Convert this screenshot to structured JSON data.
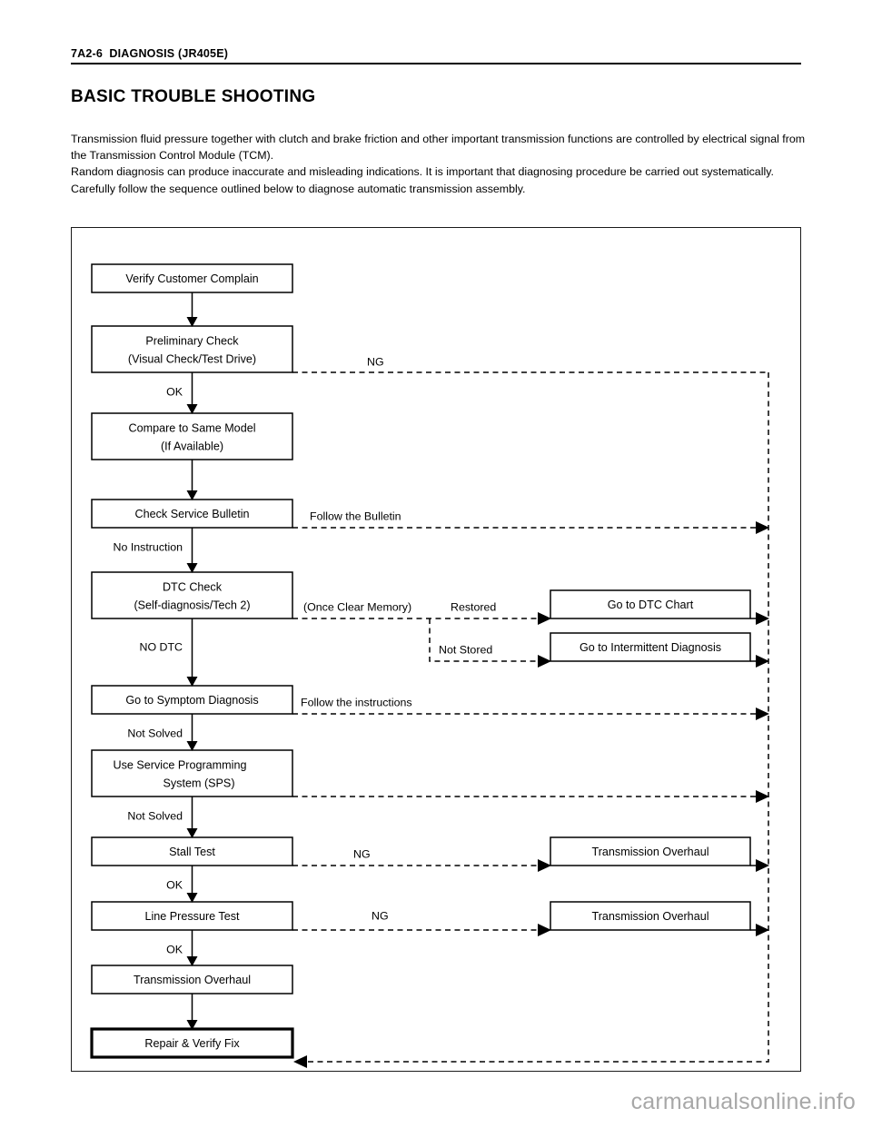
{
  "header": {
    "running_head": "7A2-6  DIAGNOSIS (JR405E)",
    "section_title": "BASIC TROUBLE SHOOTING"
  },
  "intro": {
    "para1": "Transmission fluid pressure together with clutch and brake friction and other important transmission functions are controlled by electrical signal from the Transmission Control Module (TCM).",
    "para2": "Random diagnosis can produce inaccurate and misleading indications. It is important that diagnosing procedure be carried out systematically.",
    "para3": "Carefully follow the sequence outlined below to diagnose automatic transmission assembly."
  },
  "flowchart": {
    "nodes": [
      {
        "id": "verify",
        "line1": "Verify Customer Complain",
        "line2": ""
      },
      {
        "id": "preliminary",
        "line1": "Preliminary Check",
        "line2": "(Visual Check/Test Drive)"
      },
      {
        "id": "compare",
        "line1": "Compare to Same Model",
        "line2": "(If Available)"
      },
      {
        "id": "bulletin",
        "line1": "Check Service Bulletin",
        "line2": ""
      },
      {
        "id": "dtccheck",
        "line1": "DTC Check",
        "line2": "(Self-diagnosis/Tech 2)"
      },
      {
        "id": "symptom",
        "line1": "Go to Symptom Diagnosis",
        "line2": ""
      },
      {
        "id": "sps",
        "line1": "Use Service Programming",
        "line2": "System (SPS)"
      },
      {
        "id": "stall",
        "line1": "Stall Test",
        "line2": ""
      },
      {
        "id": "linepressure",
        "line1": "Line Pressure Test",
        "line2": ""
      },
      {
        "id": "overhaul-main",
        "line1": "Transmission Overhaul",
        "line2": ""
      },
      {
        "id": "repair",
        "line1": "Repair & Verify Fix",
        "line2": ""
      },
      {
        "id": "dtcchart",
        "line1": "Go to DTC Chart",
        "line2": ""
      },
      {
        "id": "intermittent",
        "line1": "Go to Intermittent Diagnosis",
        "line2": ""
      },
      {
        "id": "overhaul-stall",
        "line1": "Transmission Overhaul",
        "line2": ""
      },
      {
        "id": "overhaul-line",
        "line1": "Transmission Overhaul",
        "line2": ""
      }
    ],
    "edge_labels": {
      "ng_preliminary": "NG",
      "ok_preliminary": "OK",
      "follow_bulletin": "Follow the Bulletin",
      "no_instruction": "No Instruction",
      "once_clear_memory": "(Once Clear Memory)",
      "restored": "Restored",
      "not_stored": "Not Stored",
      "no_dtc": "NO  DTC",
      "follow_instructions": "Follow the instructions",
      "not_solved_1": "Not Solved",
      "not_solved_2": "Not Solved",
      "ng_stall": "NG",
      "ok_stall": "OK",
      "ng_linepressure": "NG",
      "ok_linepressure": "OK"
    }
  },
  "footer": {
    "watermark": "carmanualsonline.info"
  },
  "colors": {
    "ink": "#000000",
    "frame": "#1a1a1a",
    "watermark": "#a8a8a8",
    "paper": "#ffffff"
  }
}
